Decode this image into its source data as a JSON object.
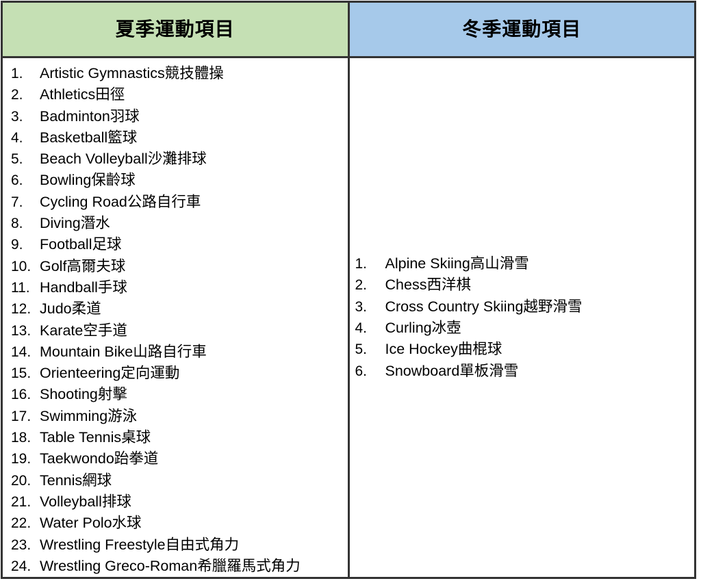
{
  "table": {
    "columns": [
      {
        "id": "summer",
        "header": "夏季運動項目",
        "header_bg": "#c5e0b4",
        "items": [
          {
            "num": "1.",
            "label": "Artistic Gymnastics競技體操"
          },
          {
            "num": "2.",
            "label": "Athletics田徑"
          },
          {
            "num": "3.",
            "label": "Badminton羽球"
          },
          {
            "num": "4.",
            "label": "Basketball籃球"
          },
          {
            "num": "5.",
            "label": "Beach Volleyball沙灘排球"
          },
          {
            "num": "6.",
            "label": "Bowling保齡球"
          },
          {
            "num": "7.",
            "label": "Cycling Road公路自行車"
          },
          {
            "num": "8.",
            "label": "Diving潛水"
          },
          {
            "num": "9.",
            "label": "Football足球"
          },
          {
            "num": "10.",
            "label": "Golf高爾夫球"
          },
          {
            "num": "11.",
            "label": "Handball手球"
          },
          {
            "num": "12.",
            "label": "Judo柔道"
          },
          {
            "num": "13.",
            "label": "Karate空手道"
          },
          {
            "num": "14.",
            "label": "Mountain Bike山路自行車"
          },
          {
            "num": "15.",
            "label": "Orienteering定向運動"
          },
          {
            "num": "16.",
            "label": "Shooting射擊"
          },
          {
            "num": "17.",
            "label": "Swimming游泳"
          },
          {
            "num": "18.",
            "label": "Table Tennis桌球"
          },
          {
            "num": "19.",
            "label": "Taekwondo跆拳道"
          },
          {
            "num": "20.",
            "label": "Tennis網球"
          },
          {
            "num": "21.",
            "label": "Volleyball排球"
          },
          {
            "num": "22.",
            "label": "Water Polo水球"
          },
          {
            "num": "23.",
            "label": "Wrestling Freestyle自由式角力"
          },
          {
            "num": "24.",
            "label": "Wrestling Greco-Roman希臘羅馬式角力"
          }
        ]
      },
      {
        "id": "winter",
        "header": "冬季運動項目",
        "header_bg": "#a6c9ea",
        "items": [
          {
            "num": "1.",
            "label": "Alpine Skiing高山滑雪"
          },
          {
            "num": "2.",
            "label": "Chess西洋棋"
          },
          {
            "num": "3.",
            "label": "Cross Country Skiing越野滑雪"
          },
          {
            "num": "4.",
            "label": "Curling冰壺"
          },
          {
            "num": "5.",
            "label": "Ice Hockey曲棍球"
          },
          {
            "num": "6.",
            "label": "Snowboard單板滑雪"
          }
        ]
      }
    ],
    "border_color": "#333333",
    "body_bg": "#ffffff",
    "text_color": "#000000"
  }
}
